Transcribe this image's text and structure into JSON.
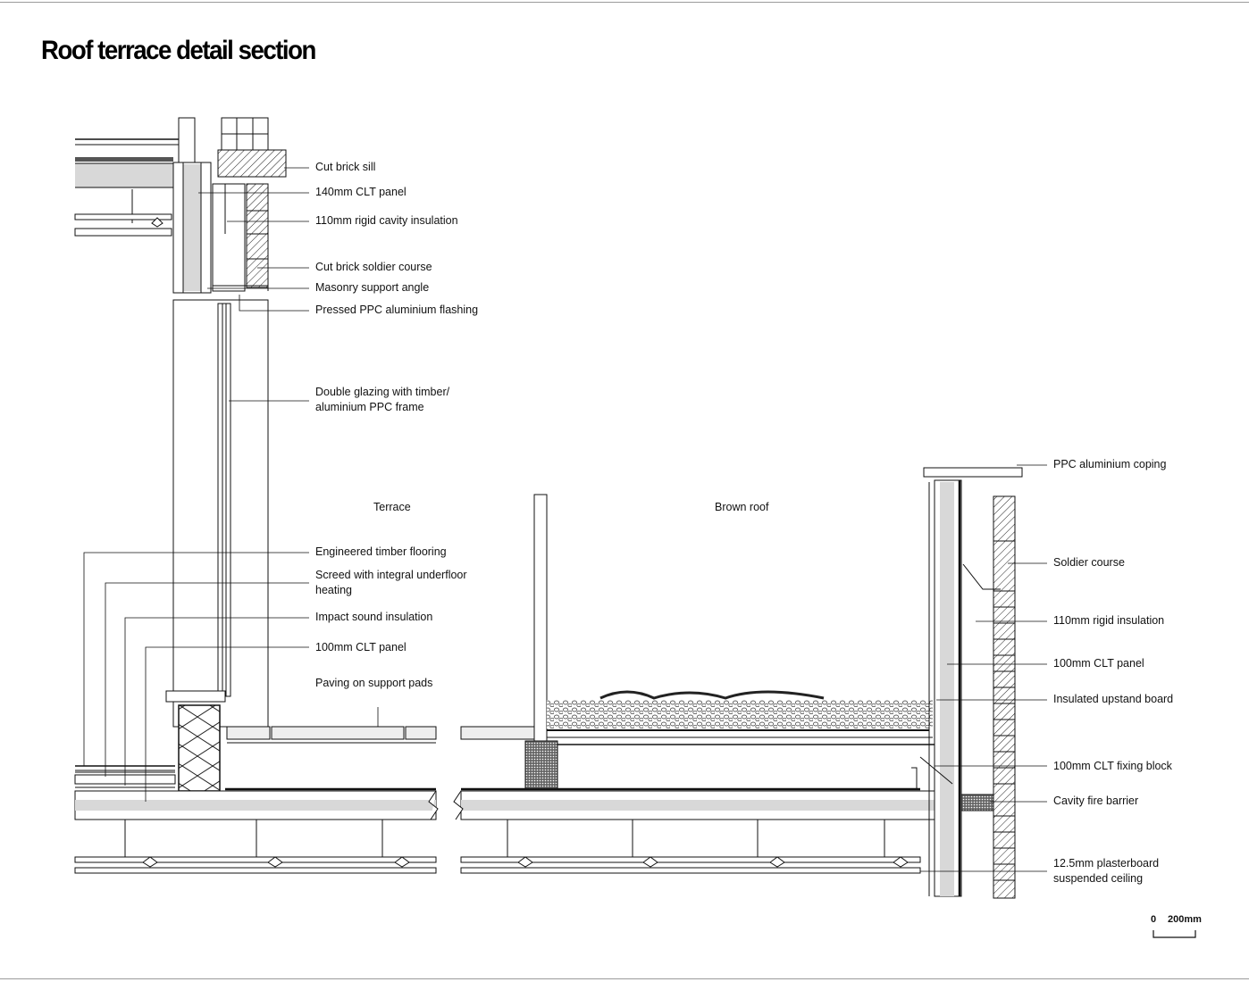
{
  "title": "Roof terrace detail section",
  "zones": {
    "terrace": "Terrace",
    "brown_roof": "Brown roof"
  },
  "labels_left": [
    {
      "id": "cut-brick-sill",
      "text": "Cut brick sill"
    },
    {
      "id": "clt-panel-140",
      "text": "140mm CLT panel"
    },
    {
      "id": "rigid-cavity-insulation",
      "text": "110mm rigid cavity insulation"
    },
    {
      "id": "cut-brick-soldier-course",
      "text": "Cut brick soldier course"
    },
    {
      "id": "masonry-support-angle",
      "text": "Masonry support angle"
    },
    {
      "id": "pressed-flashing",
      "text": "Pressed PPC aluminium flashing"
    },
    {
      "id": "double-glazing",
      "text": "Double glazing with timber/\naluminium PPC frame"
    },
    {
      "id": "timber-flooring",
      "text": "Engineered timber flooring"
    },
    {
      "id": "screed",
      "text": "Screed with integral underfloor\nheating"
    },
    {
      "id": "impact-sound",
      "text": "Impact sound insulation"
    },
    {
      "id": "clt-panel-100-left",
      "text": "100mm CLT panel"
    },
    {
      "id": "paving",
      "text": "Paving on support pads"
    }
  ],
  "labels_right": [
    {
      "id": "coping",
      "text": "PPC aluminium coping"
    },
    {
      "id": "soldier-course",
      "text": "Soldier course"
    },
    {
      "id": "rigid-insulation",
      "text": "110mm rigid insulation"
    },
    {
      "id": "clt-panel-100-right",
      "text": "100mm CLT panel"
    },
    {
      "id": "upstand-board",
      "text": "Insulated upstand board"
    },
    {
      "id": "clt-fixing-block",
      "text": "100mm CLT fixing block"
    },
    {
      "id": "cavity-fire-barrier",
      "text": "Cavity fire barrier"
    },
    {
      "id": "plasterboard-ceiling",
      "text": "12.5mm plasterboard\nsuspended ceiling"
    }
  ],
  "scale": {
    "zero": "0",
    "length": "200mm"
  }
}
